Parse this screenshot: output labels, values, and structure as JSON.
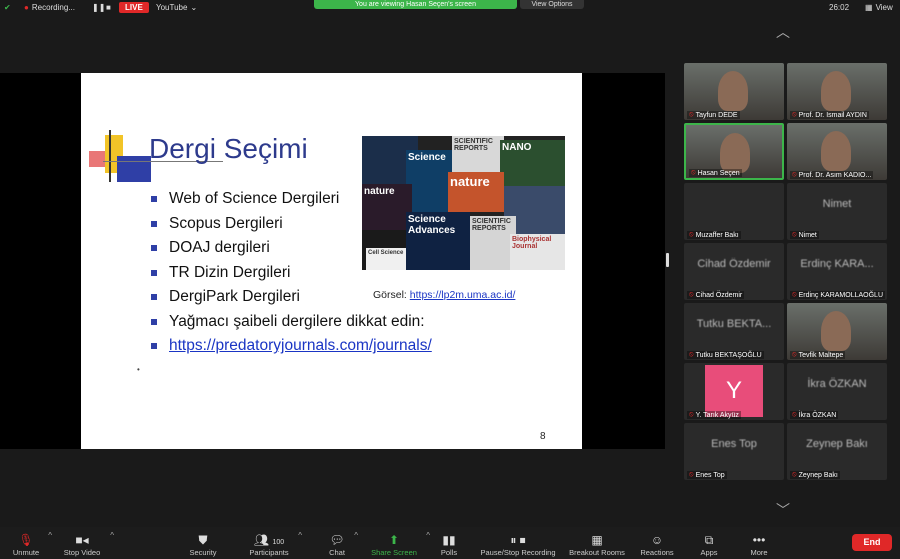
{
  "top": {
    "recording_label": "Recording...",
    "live_label": "LIVE",
    "youtube_label": "YouTube",
    "banner": "You are viewing Hasan Seçen's screen",
    "view_options": "View Options",
    "time": "26:02",
    "view_label": "View"
  },
  "slide": {
    "title": "Dergi Seçimi",
    "bullets": [
      "Web of Science Dergileri",
      "Scopus Dergileri",
      "DOAJ dergileri",
      "TR Dizin Dergileri",
      "DergiPark Dergileri",
      "Yağmacı şaibeli dergilere dikkat edin:",
      "https://predatoryjournals.com/journals/"
    ],
    "credit_prefix": "Görsel:",
    "credit_link": "https://lp2m.uma.ac.id/",
    "page_number": "8",
    "collage_labels": [
      "Science",
      "nature",
      "SCIENTIFIC REPORTS",
      "Science Advances",
      "nature",
      "SCIENTIFIC REPORTS",
      "NANO",
      "Biophysical Journal",
      "Cell Science"
    ]
  },
  "participants": [
    {
      "name": "Tayfun DEDE",
      "type": "video"
    },
    {
      "name": "Prof. Dr. Ismail AYDIN",
      "type": "video"
    },
    {
      "name": "Hasan Seçen",
      "type": "video",
      "active": true
    },
    {
      "name": "Prof. Dr. Asım KADIO...",
      "type": "video"
    },
    {
      "name": "Muzaffer Bakı",
      "type": "name",
      "big": ""
    },
    {
      "name": "Nimet",
      "type": "name",
      "big": "Nimet"
    },
    {
      "name": "Cihad Özdemir",
      "type": "name",
      "big": "Cihad Özdemir"
    },
    {
      "name": "Erdinç KARAMOLLAOĞLU",
      "type": "name",
      "big": "Erdinç KARA..."
    },
    {
      "name": "Tutku BEKTAŞOĞLU",
      "type": "name",
      "big": "Tutku BEKTA..."
    },
    {
      "name": "Tevfik Maltepe",
      "type": "video"
    },
    {
      "name": "Y. Tarık Akyüz",
      "type": "avatar",
      "big": "Y"
    },
    {
      "name": "İkra ÖZKAN",
      "type": "name",
      "big": "İkra ÖZKAN"
    },
    {
      "name": "Enes Top",
      "type": "name",
      "big": "Enes Top"
    },
    {
      "name": "Zeynep Bakı",
      "type": "name",
      "big": "Zeynep Bakı"
    }
  ],
  "toolbar": {
    "unmute": "Unmute",
    "stop_video": "Stop Video",
    "security": "Security",
    "participants": "Participants",
    "participant_count": "100",
    "chat": "Chat",
    "share_screen": "Share Screen",
    "polls": "Polls",
    "recording": "Pause/Stop Recording",
    "breakout": "Breakout Rooms",
    "reactions": "Reactions",
    "apps": "Apps",
    "more": "More",
    "end": "End"
  },
  "colors": {
    "accent_green": "#3cb54a",
    "live_red": "#e02828",
    "slide_title_blue": "#2d3a8c"
  }
}
